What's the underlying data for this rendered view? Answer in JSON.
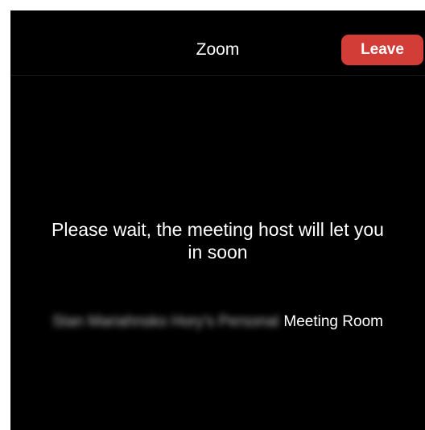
{
  "window": {
    "background": "#000000"
  },
  "header": {
    "title": "Zoom",
    "leave_label": "Leave",
    "leave_color": "#d23d37"
  },
  "waiting": {
    "message_line1": "Please wait, the meeting host will let you",
    "message_line2": "in soon"
  },
  "meeting": {
    "host_name": "Stan Mariahnsko Hory's Personal",
    "room_suffix": "Meeting Room"
  }
}
